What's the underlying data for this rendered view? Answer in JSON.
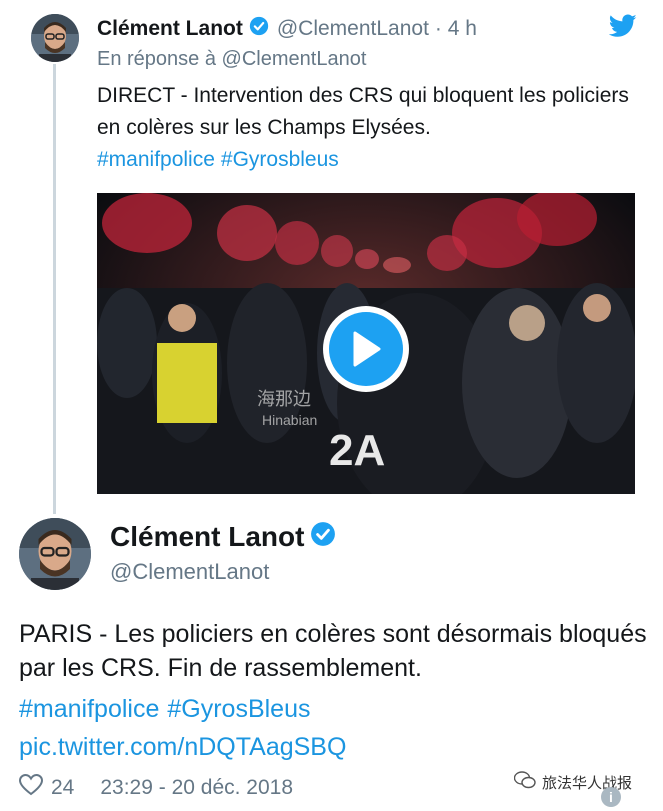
{
  "tweet1": {
    "name": "Clément Lanot",
    "handle": "@ClementLanot",
    "time": "· 4 h",
    "reply_prefix": "En réponse à",
    "reply_handle": "@ClementLanot",
    "text": "DIRECT - Intervention des CRS qui bloquent les policiers en colères sur les Champs Elysées.",
    "hashtags": [
      "#manifpolice",
      "#Gyrosbleus"
    ]
  },
  "media": {
    "type": "video",
    "overlay_text": "2A",
    "watermark_cn": "海那边",
    "watermark_en": "Hinabian"
  },
  "tweet2": {
    "name": "Clément Lanot",
    "handle": "@ClementLanot",
    "text": "PARIS - Les policiers en colères sont désormais bloqués par les CRS. Fin de rassemblement.",
    "hashtags": [
      "#manifpolice",
      "#GyrosBleus"
    ],
    "link": "pic.twitter.com/nDQTAagSBQ",
    "likes": "24",
    "timestamp": "23:29 - 20 déc. 2018"
  },
  "watermark": {
    "text": "旅法华人战报"
  },
  "icons": {
    "verified": "verified-badge-icon",
    "twitter": "twitter-bird-icon",
    "like": "heart-icon",
    "play": "play-icon",
    "info": "info-icon",
    "wechat": "wechat-icon"
  },
  "colors": {
    "link": "#1b95e0",
    "verified": "#1da1f2",
    "muted": "#657786"
  }
}
